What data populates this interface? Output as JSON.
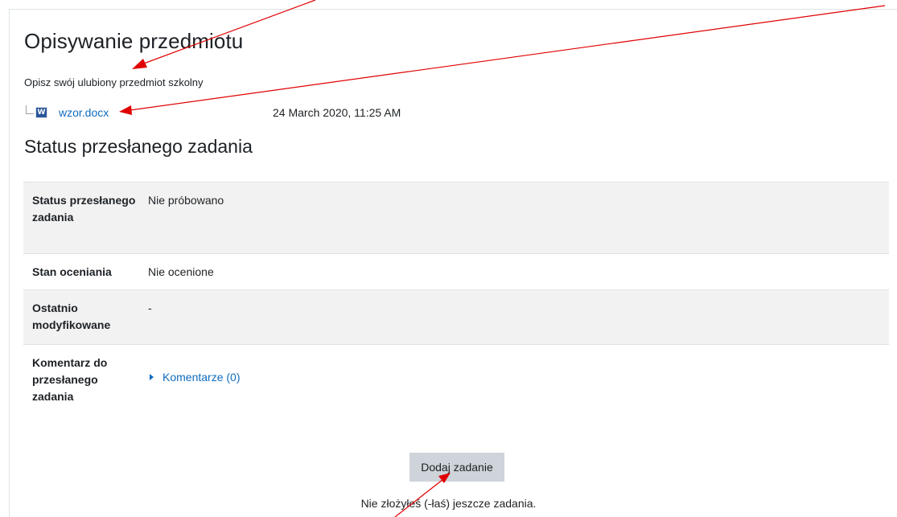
{
  "assignment": {
    "title": "Opisywanie przedmiotu",
    "description": "Opisz swój ulubiony przedmiot szkolny",
    "attachment": {
      "icon": "word-document-icon",
      "icon_glyph": "W",
      "filename": "wzor.docx",
      "date": "24 March 2020, 11:25 AM"
    }
  },
  "submission_status": {
    "heading": "Status przesłanego zadania",
    "rows": [
      {
        "label": "Status przesłanego zadania",
        "value": "Nie próbowano"
      },
      {
        "label": "Stan oceniania",
        "value": "Nie ocenione"
      },
      {
        "label": "Ostatnio modyfikowane",
        "value": "-"
      },
      {
        "label": "Komentarz do przesłanego zadania",
        "value": "Komentarze (0)"
      }
    ]
  },
  "actions": {
    "add_submission_label": "Dodaj zadanie",
    "note": "Nie złożyłeś (-łaś) jeszcze zadania."
  },
  "colors": {
    "link": "#0f6cbf",
    "annotation_arrow": "#e00000",
    "button_bg": "#ced4da",
    "row_shade": "#f2f2f2"
  }
}
